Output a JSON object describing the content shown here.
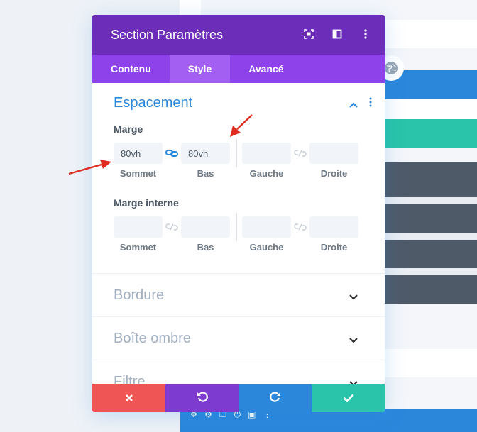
{
  "colors": {
    "header": "#6c2eb9",
    "tabs": "#8e42e9",
    "tab_active": "#a35ff2",
    "accent_blue": "#2b87da",
    "teal": "#29c4a9",
    "dark_block": "#4f5a69",
    "discard": "#ef5555",
    "undo": "#7e3bd0",
    "redo": "#2b87da",
    "save": "#29c4a9",
    "annotation_arrow": "#e02b20"
  },
  "modal": {
    "title": "Section Paramètres",
    "header_icons": [
      "fullscreen-icon",
      "split-view-icon",
      "more-vertical-icon"
    ]
  },
  "tabs": [
    {
      "label": "Contenu",
      "active": false
    },
    {
      "label": "Style",
      "active": true
    },
    {
      "label": "Avancé",
      "active": false
    }
  ],
  "spacing": {
    "title": "Espacement",
    "margin": {
      "label": "Marge",
      "fields": [
        {
          "label": "Sommet",
          "value": "80vh"
        },
        {
          "label": "Bas",
          "value": "80vh"
        },
        {
          "label": "Gauche",
          "value": ""
        },
        {
          "label": "Droite",
          "value": ""
        }
      ],
      "vertical_linked": true,
      "horizontal_linked": false
    },
    "padding": {
      "label": "Marge interne",
      "fields": [
        {
          "label": "Sommet",
          "value": ""
        },
        {
          "label": "Bas",
          "value": ""
        },
        {
          "label": "Gauche",
          "value": ""
        },
        {
          "label": "Droite",
          "value": ""
        }
      ],
      "vertical_linked": false,
      "horizontal_linked": false
    }
  },
  "sections": [
    {
      "title": "Bordure"
    },
    {
      "title": "Boîte ombre"
    },
    {
      "title": "Filtre"
    }
  ],
  "footer": {
    "buttons": [
      "close-icon",
      "undo-icon",
      "redo-icon",
      "check-icon"
    ]
  }
}
